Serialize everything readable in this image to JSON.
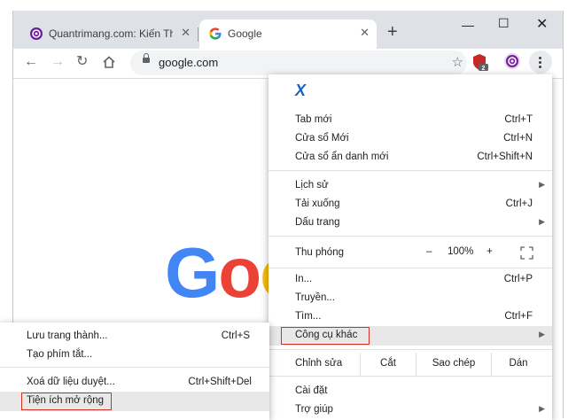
{
  "tabs": [
    {
      "title": "Quantrimang.com: Kiến Thức",
      "active": false
    },
    {
      "title": "Google",
      "active": true
    }
  ],
  "toolbar": {
    "url": "google.com",
    "extension_badge": "2"
  },
  "page": {
    "logo_text": "Goog"
  },
  "menu": {
    "app_mark": "X",
    "items": [
      {
        "label": "Tab mới",
        "shortcut": "Ctrl+T"
      },
      {
        "label": "Cửa sổ Mới",
        "shortcut": "Ctrl+N"
      },
      {
        "label": "Cửa sổ ẩn danh mới",
        "shortcut": "Ctrl+Shift+N"
      },
      {
        "label": "Lịch sử"
      },
      {
        "label": "Tải xuống",
        "shortcut": "Ctrl+J"
      },
      {
        "label": "Dấu trang"
      },
      {
        "label": "In...",
        "shortcut": "Ctrl+P"
      },
      {
        "label": "Truyền..."
      },
      {
        "label": "Tìm...",
        "shortcut": "Ctrl+F"
      },
      {
        "label": "Công cụ khác"
      },
      {
        "label": "Cài đặt"
      },
      {
        "label": "Trợ giúp"
      }
    ],
    "zoom": {
      "label": "Thu phóng",
      "minus": "–",
      "value": "100%",
      "plus": "+"
    },
    "edit": {
      "label": "Chỉnh sửa",
      "cut": "Cắt",
      "copy": "Sao chép",
      "paste": "Dán"
    }
  },
  "submenu": {
    "items": [
      {
        "label": "Lưu trang thành...",
        "shortcut": "Ctrl+S"
      },
      {
        "label": "Tạo phím tắt..."
      },
      {
        "label": "Xoá dữ liệu duyệt...",
        "shortcut": "Ctrl+Shift+Del"
      },
      {
        "label": "Tiện ích mở rộng"
      }
    ]
  },
  "colors": {
    "highlight_border": "#d93025",
    "google_blue": "#4285f4",
    "google_red": "#ea4335",
    "google_yellow": "#fbbc05"
  },
  "icons": [
    "quantrimang-favicon",
    "google-favicon",
    "close-icon",
    "new-tab-icon",
    "minimize-icon",
    "maximize-icon",
    "window-close-icon",
    "back-icon",
    "forward-icon",
    "reload-icon",
    "home-icon",
    "lock-icon",
    "bookmark-star-icon",
    "shield-extension-icon",
    "profile-extension-icon",
    "menu-kebab-icon",
    "fullscreen-icon",
    "chevron-right-icon"
  ]
}
